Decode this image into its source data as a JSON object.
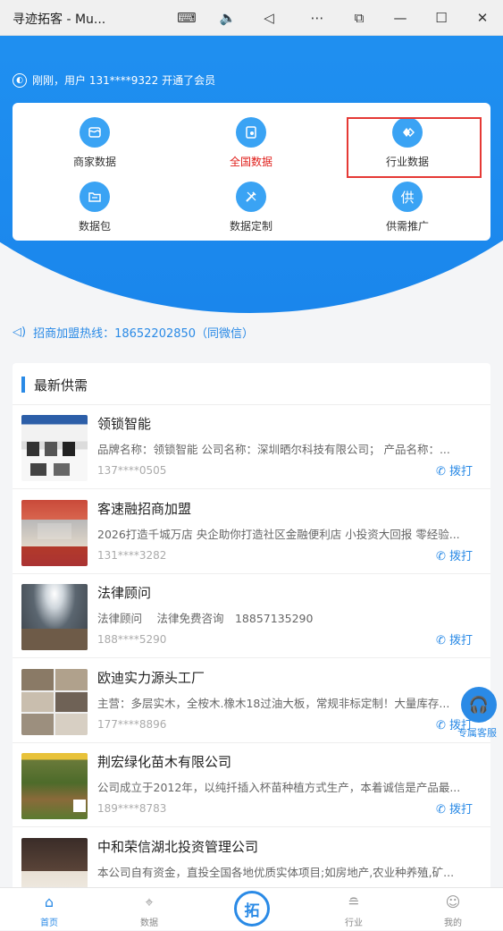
{
  "window": {
    "title": "寻迹拓客 - Mu...",
    "controls": [
      "keyboard-icon",
      "volume-icon",
      "back-icon",
      "more-icon",
      "restore-icon",
      "minimize-icon",
      "maximize-icon",
      "close-icon"
    ]
  },
  "notice": {
    "text": "刚刚，用户 131****9322 开通了会员"
  },
  "grid": {
    "items": [
      {
        "label": "商家数据",
        "icon": "shop-data-icon"
      },
      {
        "label": "全国数据",
        "icon": "nation-data-icon"
      },
      {
        "label": "行业数据",
        "icon": "industry-data-icon"
      },
      {
        "label": "数据包",
        "icon": "folder-icon"
      },
      {
        "label": "数据定制",
        "icon": "custom-tool-icon"
      },
      {
        "label": "供需推广",
        "icon": "supply-icon",
        "glyph": "供"
      }
    ]
  },
  "hotline": {
    "text": "招商加盟热线：18652202850（同微信）"
  },
  "section": {
    "title": "最新供需"
  },
  "call_label": "拨打",
  "items": [
    {
      "name": "领锁智能",
      "desc": "品牌名称：领锁智能 公司名称：深圳晒尔科技有限公司； 产品名称：...",
      "phone": "137****0505"
    },
    {
      "name": "客速融招商加盟",
      "desc": "2026打造千城万店 央企助你打造社区金融便利店 小投资大回报 零经验...",
      "phone": "131****3282"
    },
    {
      "name": "法律顾问",
      "desc": "法律顾问　 法律免费咨询　18857135290",
      "phone": "188****5290"
    },
    {
      "name": "欧迪实力源头工厂",
      "desc": "主营：多层实木，全桉木.橡木18过油大板，常规非标定制！大量库存...",
      "phone": "177****8896"
    },
    {
      "name": "荆宏绿化苗木有限公司",
      "desc": "公司成立于2012年，以纯扦插入杯苗种植方式生产，本着诚信是产品最...",
      "phone": "189****8783"
    },
    {
      "name": "中和荣信湖北投资管理公司",
      "desc": "本公司自有资金，直投全国各地优质实体项目;如房地产,农业种养殖,矿...",
      "phone": ""
    }
  ],
  "float_service": {
    "label": "专属客服"
  },
  "tabbar": {
    "tabs": [
      {
        "label": "首页",
        "icon": "home-icon",
        "active": true
      },
      {
        "label": "数据",
        "icon": "map-icon",
        "active": false
      },
      {
        "label": "行业",
        "icon": "database-icon",
        "active": false
      },
      {
        "label": "我的",
        "icon": "user-icon",
        "active": false
      }
    ],
    "center": {
      "glyph": "拓",
      "icon": "tuo-center-icon"
    }
  },
  "colors": {
    "primary": "#2196f3",
    "accent": "#2a8ae6",
    "highlight": "#e53935",
    "red_label": "#e0201c"
  }
}
